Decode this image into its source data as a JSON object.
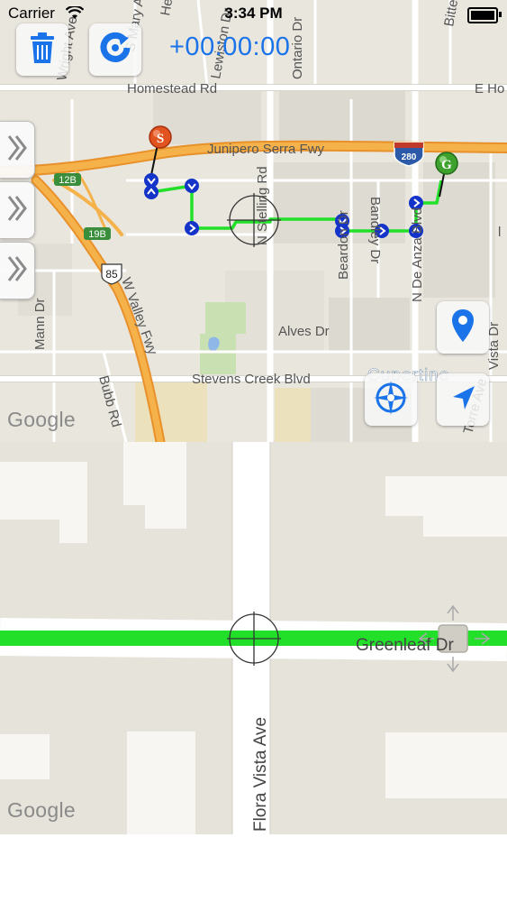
{
  "status_bar": {
    "carrier": "Carrier",
    "time": "3:34 PM"
  },
  "toolbar": {
    "timer": "+00:00:00"
  },
  "map_top": {
    "roads": {
      "homestead": "Homestead Rd",
      "e_ho": "E Ho",
      "junipero": "Junipero Serra Fwy",
      "stevens": "Stevens Creek Blvd",
      "alves": "Alves Dr",
      "n_stelling": "N Stelling Rd",
      "ontario": "Ontario Dr",
      "lewiston": "Lewiston Dr",
      "mary": "S Mary Ave",
      "helen": "Helen",
      "wright": "Wright Ave",
      "w_valley": "W Valley Fwy",
      "mann": "Mann Dr",
      "bubb": "Bubb Rd",
      "beardon": "Beardon Dr",
      "bandley": "Bandley Dr",
      "n_de_anza": "N De Anza Blvd",
      "vista": "Vista Dr",
      "torre": "Torre Ave",
      "bitter": "Bitte",
      "cupertino": "Cupertino"
    },
    "shields": {
      "i280": "280",
      "r85": "85",
      "x12b": "12B",
      "x19b": "19B"
    },
    "start_marker": "S",
    "goal_marker": "G",
    "attribution": "Google",
    "cut": "l"
  },
  "map_bottom": {
    "roads": {
      "greenleaf": "Greenleaf Dr",
      "flora": "Flora Vista Ave"
    },
    "attribution": "Google"
  },
  "colors": {
    "route": "#22e02a",
    "accent": "#1a73e8",
    "freeway": "#f3a83b",
    "waypoint": "#1433c9"
  }
}
